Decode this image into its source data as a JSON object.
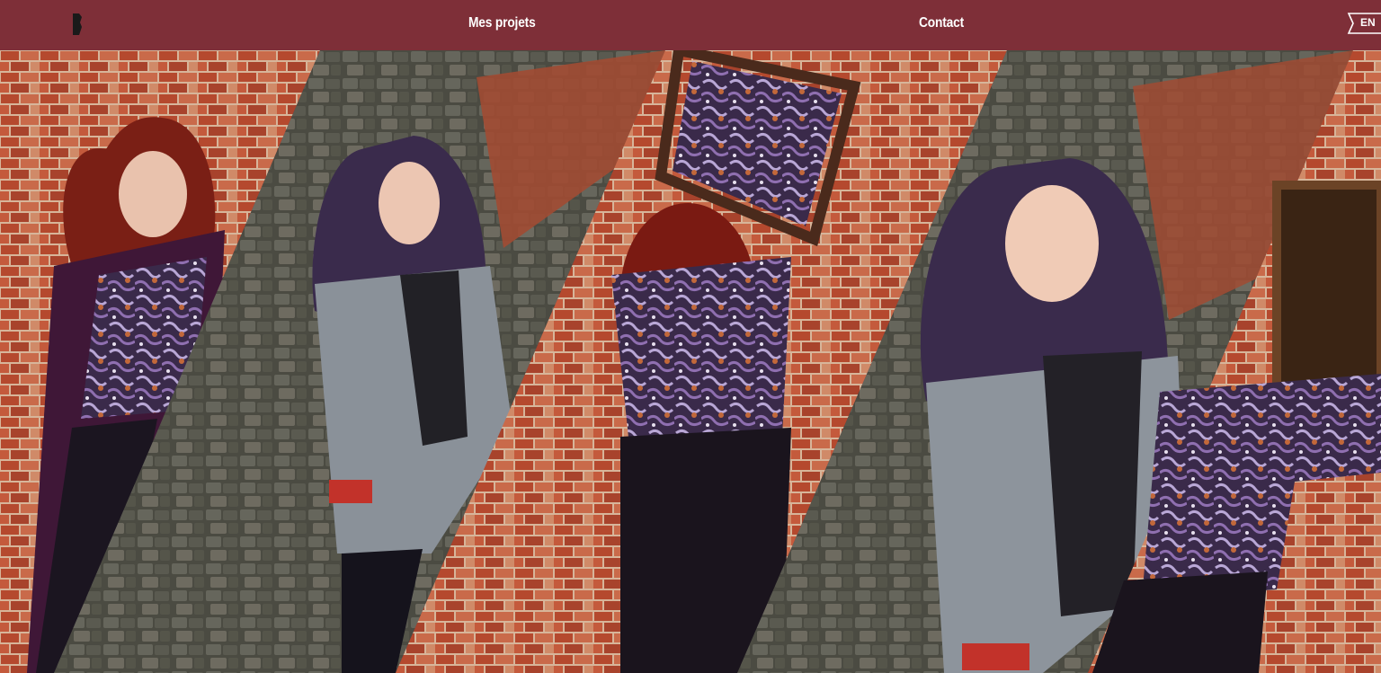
{
  "header": {
    "logo_icon": "b-logo-icon",
    "nav": {
      "projects_label": "Mes projets",
      "contact_label": "Contact"
    },
    "language_label": "EN"
  },
  "hero": {
    "description_icon": "photo-collage",
    "panels": [
      "red-hair-woman-purple-coat",
      "purple-hair-woman-grey-blazer",
      "woman-holding-mirror",
      "purple-hair-woman-closeup",
      "woman-with-frame"
    ]
  },
  "colors": {
    "brand": "#7e2f38",
    "text": "#ffffff",
    "logo": "#1a1a1a"
  }
}
